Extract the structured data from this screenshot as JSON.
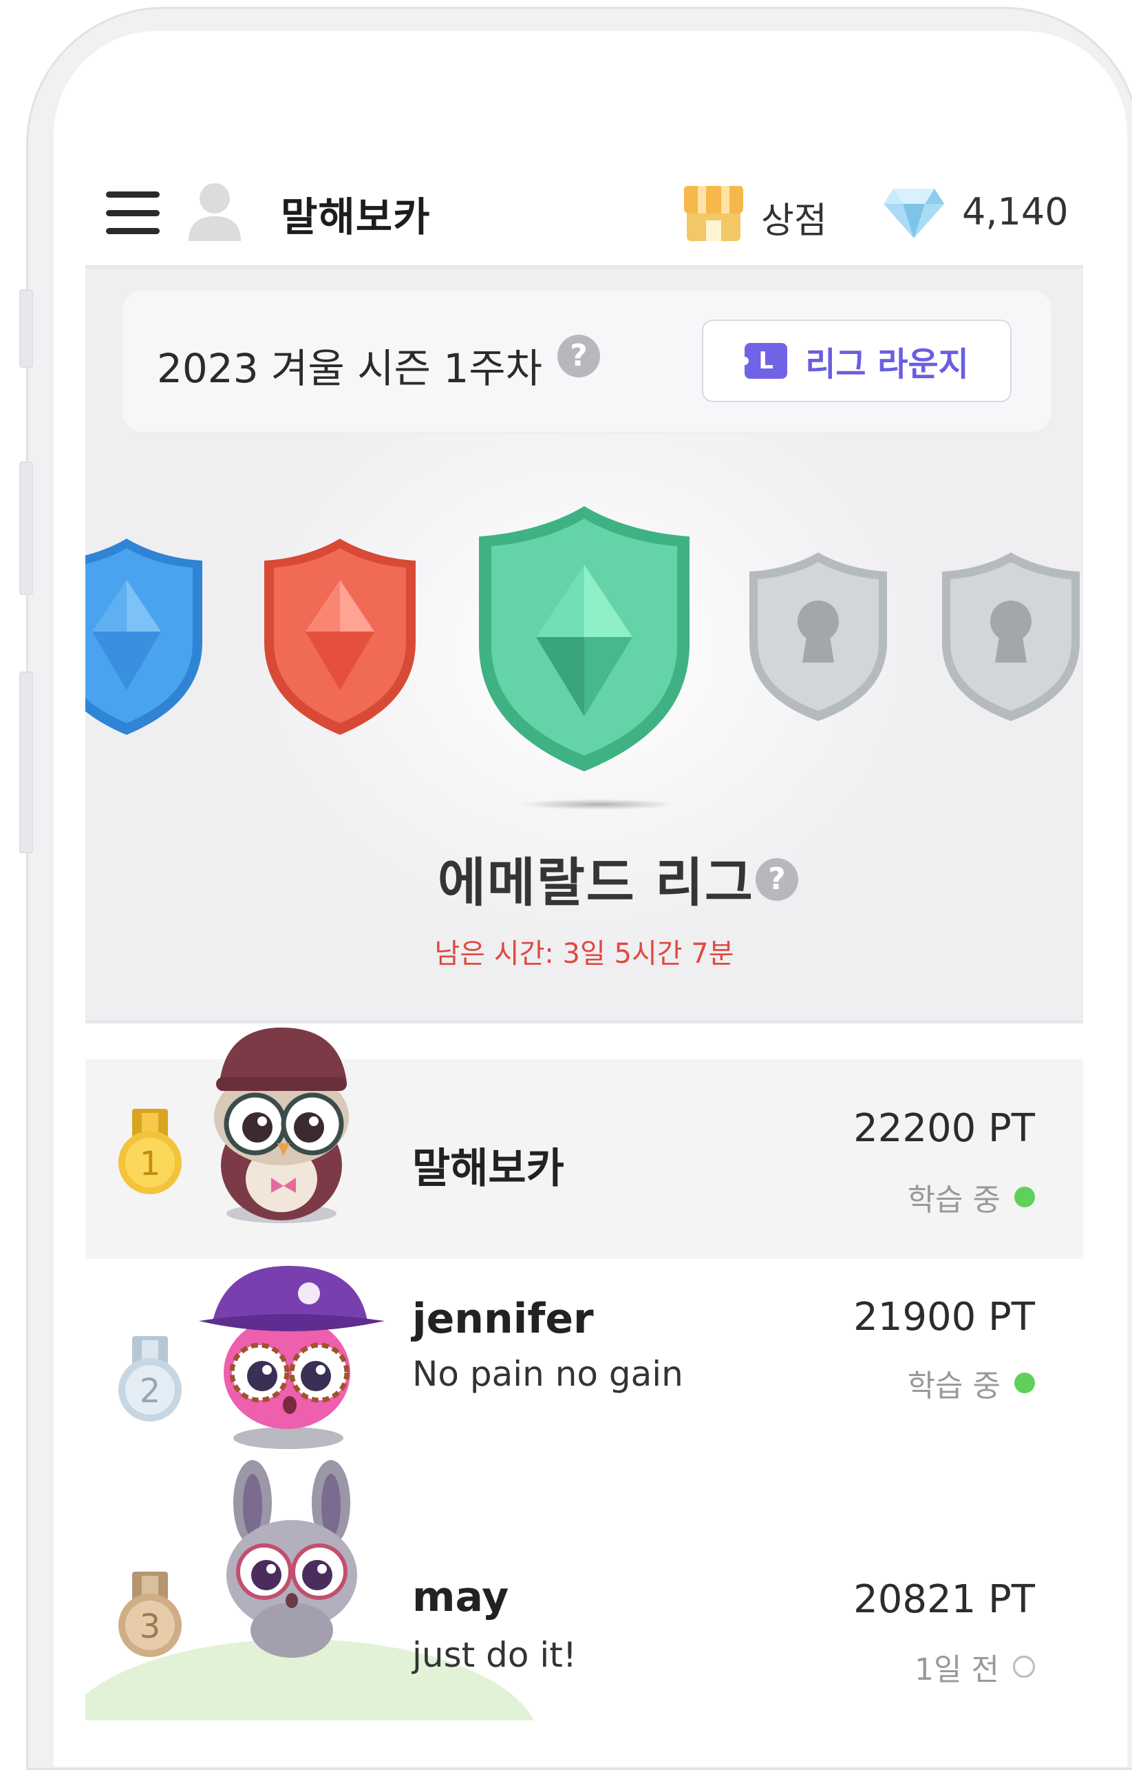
{
  "header": {
    "app_title": "말해보카",
    "shop_label": "상점",
    "gem_count": "4,140"
  },
  "season": {
    "title": "2023 겨울 시즌 1주차",
    "help": "?",
    "lounge_label": "리그 라운지",
    "lounge_icon_letter": "L"
  },
  "league": {
    "name": "에메랄드 리그",
    "help": "?",
    "time_left": "남은 시간: 3일 5시간 7분",
    "badges": [
      "sapphire-badge",
      "ruby-badge",
      "emerald-badge",
      "locked-badge",
      "locked-badge"
    ]
  },
  "ranking": [
    {
      "rank": "1",
      "name": "말해보카",
      "status": "",
      "points": "22200 PT",
      "activity": "학습 중",
      "online": true
    },
    {
      "rank": "2",
      "name": "jennifer",
      "status": "No pain no gain",
      "points": "21900 PT",
      "activity": "학습 중",
      "online": true
    },
    {
      "rank": "3",
      "name": "may",
      "status": "just do it!",
      "points": "20821 PT",
      "activity": "1일 전",
      "online": false
    }
  ],
  "colors": {
    "accent": "#6a5ee0",
    "emerald": "#5ccea0",
    "ruby": "#ee5a45",
    "sapphire": "#3f9ee8",
    "locked": "#c8cbcd",
    "alert": "#e0493f",
    "online": "#5fd05a"
  }
}
